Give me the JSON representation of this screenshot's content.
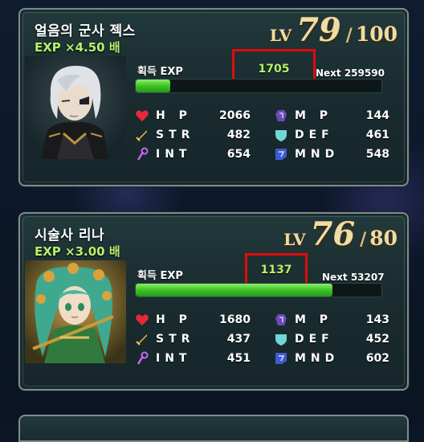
{
  "characters": [
    {
      "name": "얼음의 군사 젝스",
      "exp_rate": "EXP ×4.50 배",
      "level": {
        "lv_label": "LV",
        "current": "79",
        "max": "100"
      },
      "exp_label": "획득 EXP",
      "exp_gained": "1705",
      "next_label": "Next 259590",
      "exp_fraction": 0.14,
      "stats": {
        "hp_label": "H P",
        "hp": "2066",
        "mp_label": "M P",
        "mp": "144",
        "str_label": "STR",
        "str": "482",
        "def_label": "DEF",
        "def": "461",
        "int_label": "INT",
        "int": "654",
        "mnd_label": "MND",
        "mnd": "548"
      }
    },
    {
      "name": "시술사 리나",
      "exp_rate": "EXP ×3.00 배",
      "level": {
        "lv_label": "LV",
        "current": "76",
        "max": "80"
      },
      "exp_label": "획득 EXP",
      "exp_gained": "1137",
      "next_label": "Next 53207",
      "exp_fraction": 0.8,
      "stats": {
        "hp_label": "H P",
        "hp": "1680",
        "mp_label": "M P",
        "mp": "143",
        "str_label": "STR",
        "str": "437",
        "def_label": "DEF",
        "def": "452",
        "int_label": "INT",
        "int": "451",
        "mnd_label": "MND",
        "mnd": "602"
      }
    }
  ],
  "icons": {
    "hp": "heart-icon",
    "mp": "mp-potion-icon",
    "str": "sword-icon",
    "def": "shield-icon",
    "int": "staff-icon",
    "mnd": "mind-icon"
  },
  "colors": {
    "exp_text": "#b8f06a",
    "highlight_box": "#e10b0b",
    "level_gold": "#f0dca4",
    "bar_green": "#3fc226"
  }
}
